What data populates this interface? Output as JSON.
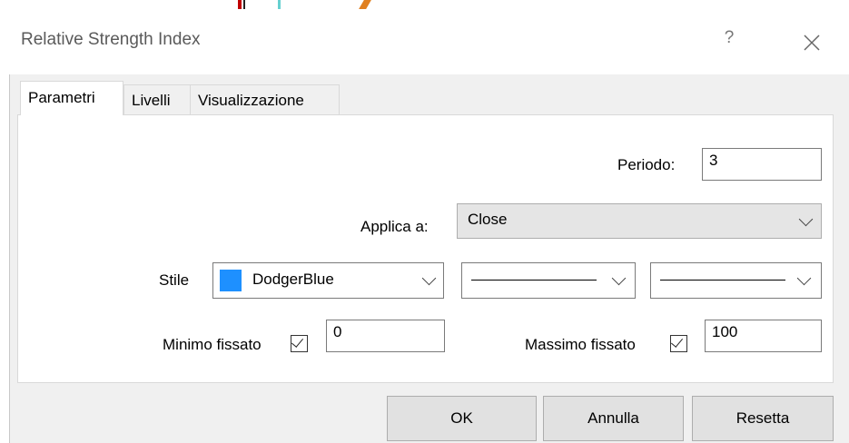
{
  "window": {
    "title": "Relative Strength Index",
    "help_glyph": "?",
    "close_glyph": "×"
  },
  "tabs": [
    {
      "label": "Parametri",
      "active": true
    },
    {
      "label": "Livelli",
      "active": false
    },
    {
      "label": "Visualizzazione",
      "active": false
    }
  ],
  "params": {
    "period_label": "Periodo:",
    "period_value": "3",
    "apply_label": "Applica a:",
    "apply_value": "Close",
    "style_label": "Stile",
    "color_name": "DodgerBlue",
    "color_hex": "#1e90ff",
    "line_style": "solid",
    "line_width": "thin",
    "min_label": "Minimo fissato",
    "min_checked": true,
    "min_value": "0",
    "max_label": "Massimo fissato",
    "max_checked": true,
    "max_value": "100"
  },
  "buttons": {
    "ok": "OK",
    "cancel": "Annulla",
    "reset": "Resetta"
  }
}
